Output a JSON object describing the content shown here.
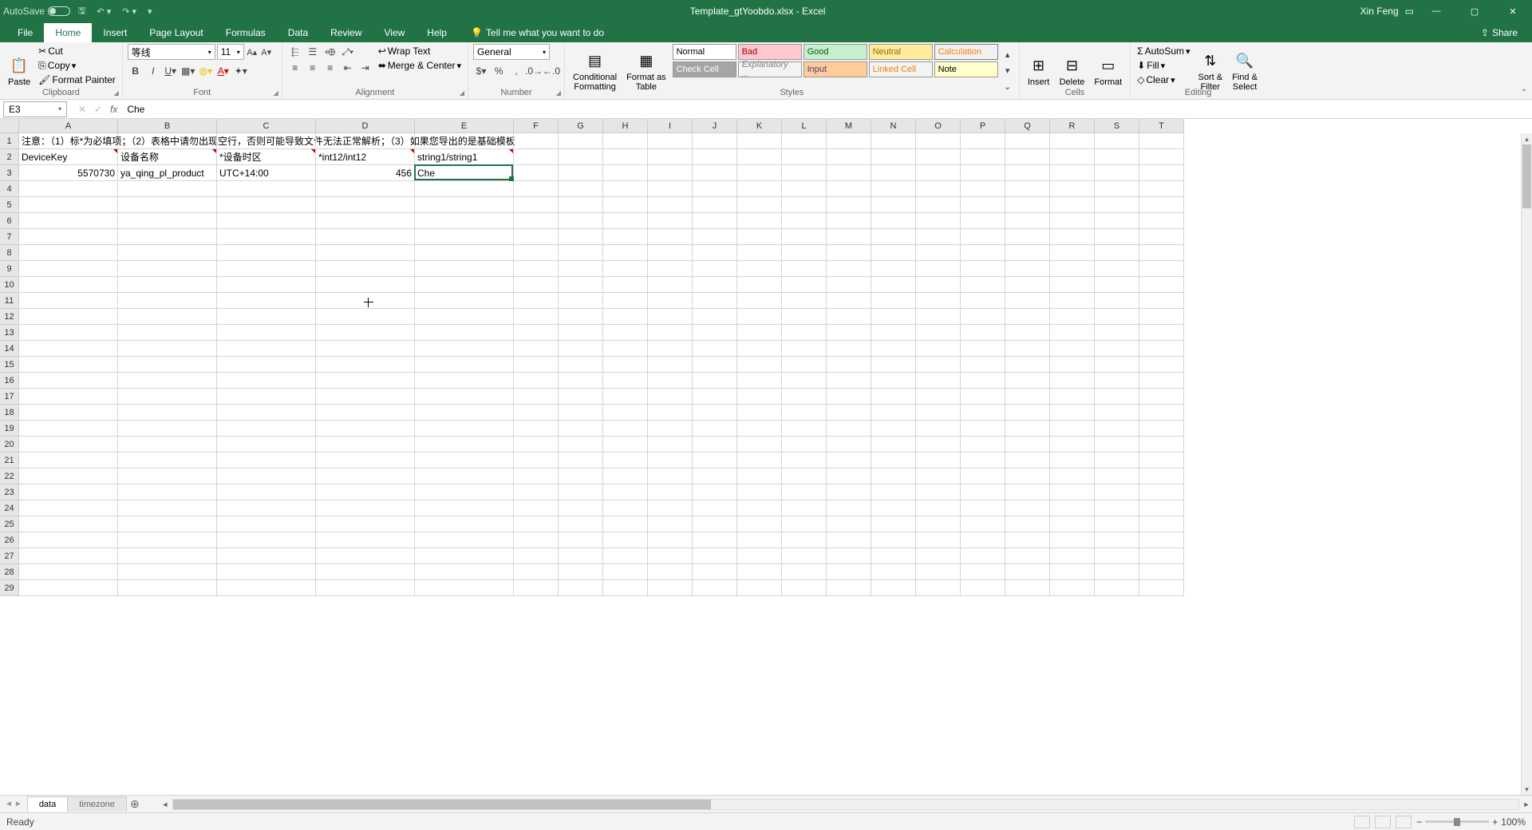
{
  "titlebar": {
    "autosave": "AutoSave",
    "autosave_state": "Off",
    "doc_title": "Template_gtYoobdo.xlsx - Excel",
    "user": "Xin Feng"
  },
  "tabs": {
    "file": "File",
    "home": "Home",
    "insert": "Insert",
    "page_layout": "Page Layout",
    "formulas": "Formulas",
    "data": "Data",
    "review": "Review",
    "view": "View",
    "help": "Help",
    "tellme": "Tell me what you want to do",
    "share": "Share"
  },
  "ribbon": {
    "clipboard": {
      "label": "Clipboard",
      "paste": "Paste",
      "cut": "Cut",
      "copy": "Copy",
      "format_painter": "Format Painter"
    },
    "font": {
      "label": "Font",
      "name": "等线",
      "size": "11"
    },
    "alignment": {
      "label": "Alignment",
      "wrap": "Wrap Text",
      "merge": "Merge & Center"
    },
    "number": {
      "label": "Number",
      "format": "General"
    },
    "styles": {
      "label": "Styles",
      "cond": "Conditional\nFormatting",
      "table": "Format as\nTable",
      "cells": {
        "normal": "Normal",
        "bad": "Bad",
        "good": "Good",
        "neutral": "Neutral",
        "calculation": "Calculation",
        "check": "Check Cell",
        "explanatory": "Explanatory ...",
        "input": "Input",
        "linked": "Linked Cell",
        "note": "Note"
      }
    },
    "cells": {
      "label": "Cells",
      "insert": "Insert",
      "delete": "Delete",
      "format": "Format"
    },
    "editing": {
      "label": "Editing",
      "autosum": "AutoSum",
      "fill": "Fill",
      "clear": "Clear",
      "sort": "Sort &\nFilter",
      "find": "Find &\nSelect"
    }
  },
  "formula_bar": {
    "ref": "E3",
    "value": "Che"
  },
  "grid": {
    "col_widths": {
      "A": 124,
      "B": 124,
      "C": 124,
      "D": 124,
      "E": 124,
      "rest": 56
    },
    "columns": [
      "A",
      "B",
      "C",
      "D",
      "E",
      "F",
      "G",
      "H",
      "I",
      "J",
      "K",
      "L",
      "M",
      "N",
      "O",
      "P",
      "Q",
      "R",
      "S",
      "T"
    ],
    "visible_rows": 29,
    "rows": [
      {
        "n": 1,
        "cells": {
          "A": "注意：（1）标*为必填项；（2）表格中请勿出现空行，否则可能导致文件无法正常解析；（3）如果您导出的是基础模板"
        }
      },
      {
        "n": 2,
        "cells": {
          "A": "DeviceKey",
          "B": "设备名称",
          "C": "*设备时区",
          "D": "*int12/int12",
          "E": "string1/string1"
        },
        "comments": [
          "A",
          "B",
          "C",
          "D",
          "E"
        ]
      },
      {
        "n": 3,
        "cells": {
          "A": "5570730",
          "B": "ya_qing_pl_product",
          "C": "UTC+14:00",
          "D": "456",
          "E": "Che"
        },
        "ralign": [
          "A",
          "D"
        ]
      }
    ],
    "active": {
      "ref": "E3",
      "col": "E",
      "row": 3
    }
  },
  "sheet_tabs": {
    "active": "data",
    "tabs": [
      "data",
      "timezone"
    ]
  },
  "statusbar": {
    "state": "Ready",
    "zoom": "100%"
  }
}
